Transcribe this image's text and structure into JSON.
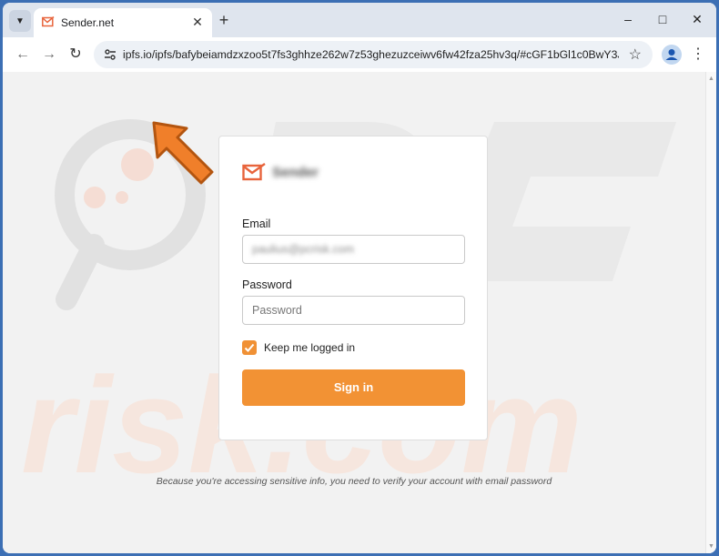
{
  "browser": {
    "tab": {
      "title": "Sender.net",
      "favicon": "envelope-check-icon"
    },
    "address_bar": {
      "url": "ipfs.io/ipfs/bafybeiamdzxzoo5t7fs3ghhze262w7z53ghezuzceiwv6fw42fza25hv3q/#cGF1bGl1c0BwY3Jpc2su..."
    },
    "icons": {
      "tab_list": "chevron-down-icon",
      "close": "close-icon",
      "new_tab": "plus-icon",
      "minimize": "minimize-icon",
      "maximize": "maximize-icon",
      "window_close": "close-icon",
      "back": "arrow-left-icon",
      "forward": "arrow-right-icon",
      "reload": "reload-icon",
      "site_info": "tune-icon",
      "bookmark": "star-icon",
      "profile": "person-icon",
      "menu": "three-dots-icon"
    }
  },
  "login": {
    "brand_icon": "envelope-check-icon",
    "brand_name": "Sender",
    "email_label": "Email",
    "email_value": "paulius@pcrisk.com",
    "password_label": "Password",
    "password_placeholder": "Password",
    "remember_label": "Keep me logged in",
    "remember_checked": true,
    "submit_label": "Sign in"
  },
  "notice": "Because you're accessing sensitive info, you need to verify your account with email password",
  "colors": {
    "accent": "#f29234",
    "brand_icon": "#e8643c",
    "frame": "#3c6fb4"
  }
}
